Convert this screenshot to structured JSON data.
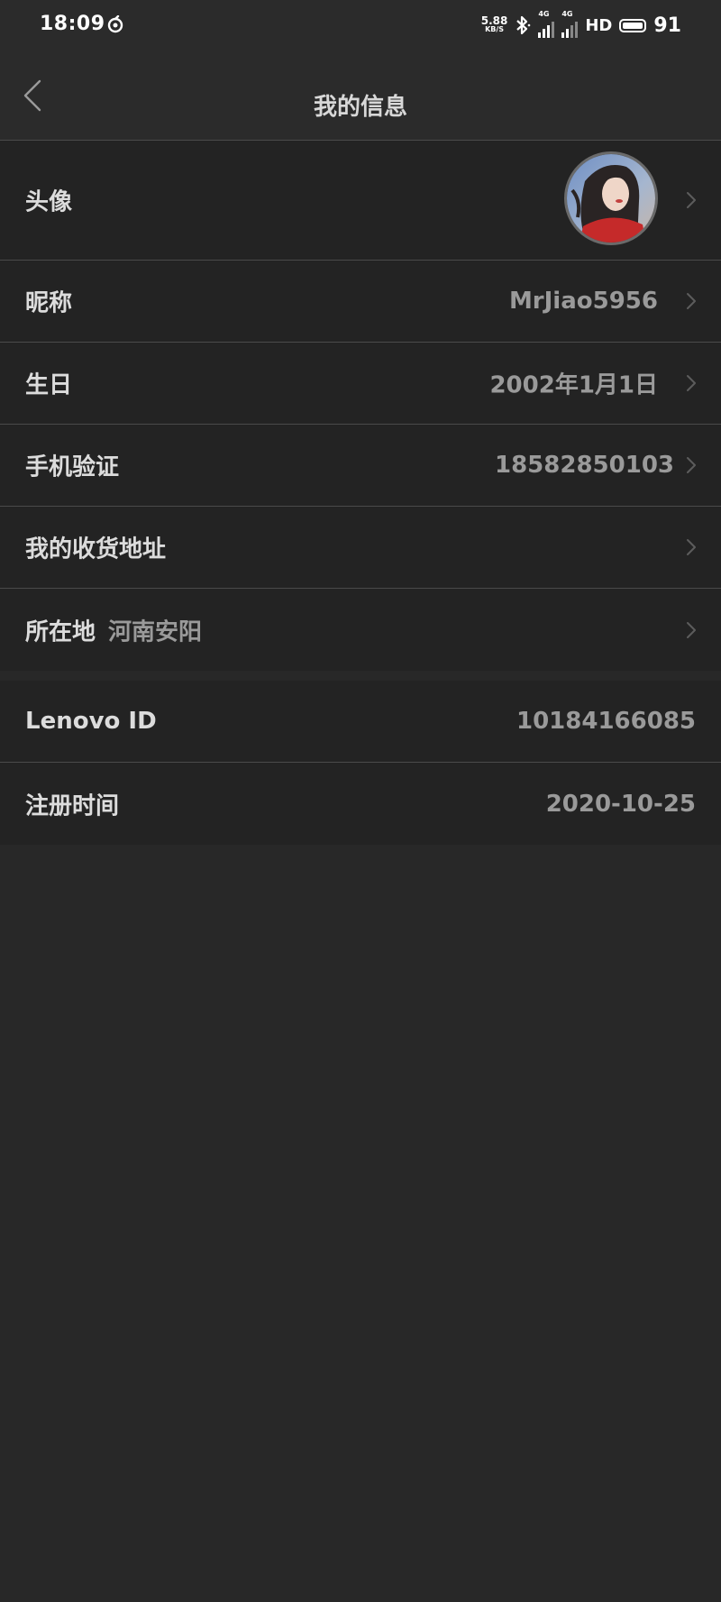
{
  "status_bar": {
    "time": "18:09",
    "net_speed_value": "5.88",
    "net_speed_unit": "KB/S",
    "signal_1_tag": "4G",
    "signal_2_tag": "4G",
    "hd_label": "HD",
    "battery_level": "91"
  },
  "header": {
    "title": "我的信息"
  },
  "rows": {
    "avatar_label": "头像",
    "nickname_label": "昵称",
    "nickname_value": "MrJiao5956",
    "birthday_label": "生日",
    "birthday_value": "2002年1月1日",
    "phone_label": "手机验证",
    "phone_value": "18582850103",
    "address_label": "我的收货地址",
    "location_label": "所在地",
    "location_value": "河南安阳",
    "lenovo_id_label": "Lenovo ID",
    "lenovo_id_value": "10184166085",
    "register_label": "注册时间",
    "register_value": "2020-10-25"
  }
}
